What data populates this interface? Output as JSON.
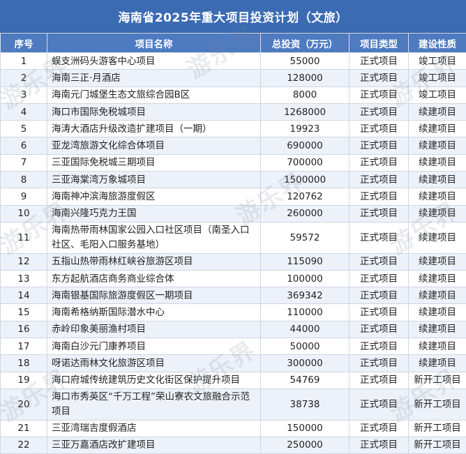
{
  "title": "海南省2025年重大项目投资计划（文旅）",
  "headers": [
    "序号",
    "项目名称",
    "总投资（万元）",
    "项目类型",
    "建设性质"
  ],
  "watermark": "游乐界",
  "rows": [
    {
      "no": "1",
      "name": "蜈支洲码头游客中心项目",
      "investment": "55000",
      "type": "正式项目",
      "nature": "竣工项目"
    },
    {
      "no": "2",
      "name": "海南三正·月酒店",
      "investment": "128000",
      "type": "正式项目",
      "nature": "竣工项目"
    },
    {
      "no": "3",
      "name": "海南元门城堡生态文旅综合园B区",
      "investment": "8000",
      "type": "正式项目",
      "nature": "竣工项目"
    },
    {
      "no": "4",
      "name": "海口市国际免税城项目",
      "investment": "1268000",
      "type": "正式项目",
      "nature": "续建项目"
    },
    {
      "no": "5",
      "name": "海涛大酒店升级改造扩建项目（一期）",
      "investment": "19923",
      "type": "正式项目",
      "nature": "续建项目"
    },
    {
      "no": "6",
      "name": "亚龙湾旅游文化综合体项目",
      "investment": "690000",
      "type": "正式项目",
      "nature": "续建项目"
    },
    {
      "no": "7",
      "name": "三亚国际免税城三期项目",
      "investment": "700000",
      "type": "正式项目",
      "nature": "续建项目"
    },
    {
      "no": "8",
      "name": "三亚海棠湾万象城项目",
      "investment": "1500000",
      "type": "正式项目",
      "nature": "续建项目"
    },
    {
      "no": "9",
      "name": "海南神冲滨海旅游度假区",
      "investment": "120762",
      "type": "正式项目",
      "nature": "续建项目"
    },
    {
      "no": "10",
      "name": "海南兴隆巧克力王国",
      "investment": "260000",
      "type": "正式项目",
      "nature": "续建项目"
    },
    {
      "no": "11",
      "name": "海南热带雨林国家公园入口社区项目（南圣入口社区、毛阳入口服务基地）",
      "investment": "59572",
      "type": "正式项目",
      "nature": "续建项目"
    },
    {
      "no": "12",
      "name": "五指山热带雨林红峡谷旅游区项目",
      "investment": "115090",
      "type": "正式项目",
      "nature": "续建项目"
    },
    {
      "no": "13",
      "name": "东方起航酒店商务商业综合体",
      "investment": "100000",
      "type": "正式项目",
      "nature": "续建项目"
    },
    {
      "no": "14",
      "name": "海南银基国际旅游度假区一期项目",
      "investment": "369342",
      "type": "正式项目",
      "nature": "续建项目"
    },
    {
      "no": "15",
      "name": "海南希格纳斯国际潜水中心",
      "investment": "110000",
      "type": "正式项目",
      "nature": "续建项目"
    },
    {
      "no": "16",
      "name": "赤岭印象美丽渔村项目",
      "investment": "44000",
      "type": "正式项目",
      "nature": "续建项目"
    },
    {
      "no": "17",
      "name": "海南白沙元门康养项目",
      "investment": "50000",
      "type": "正式项目",
      "nature": "续建项目"
    },
    {
      "no": "18",
      "name": "呀诺达雨林文化旅游区项目",
      "investment": "300000",
      "type": "正式项目",
      "nature": "续建项目"
    },
    {
      "no": "19",
      "name": "海口府城传统建筑历史文化街区保护提升项目",
      "investment": "54769",
      "type": "正式项目",
      "nature": "新开工项目"
    },
    {
      "no": "20",
      "name": "海口市秀英区“千万工程”荣山寮农文旅融合示范项目",
      "investment": "38738",
      "type": "正式项目",
      "nature": "新开工项目"
    },
    {
      "no": "21",
      "name": "三亚湾瑞吉度假酒店",
      "investment": "150000",
      "type": "正式项目",
      "nature": "新开工项目"
    },
    {
      "no": "22",
      "name": "三亚万嘉酒店改扩建项目",
      "investment": "250000",
      "type": "正式项目",
      "nature": "新开工项目"
    }
  ]
}
